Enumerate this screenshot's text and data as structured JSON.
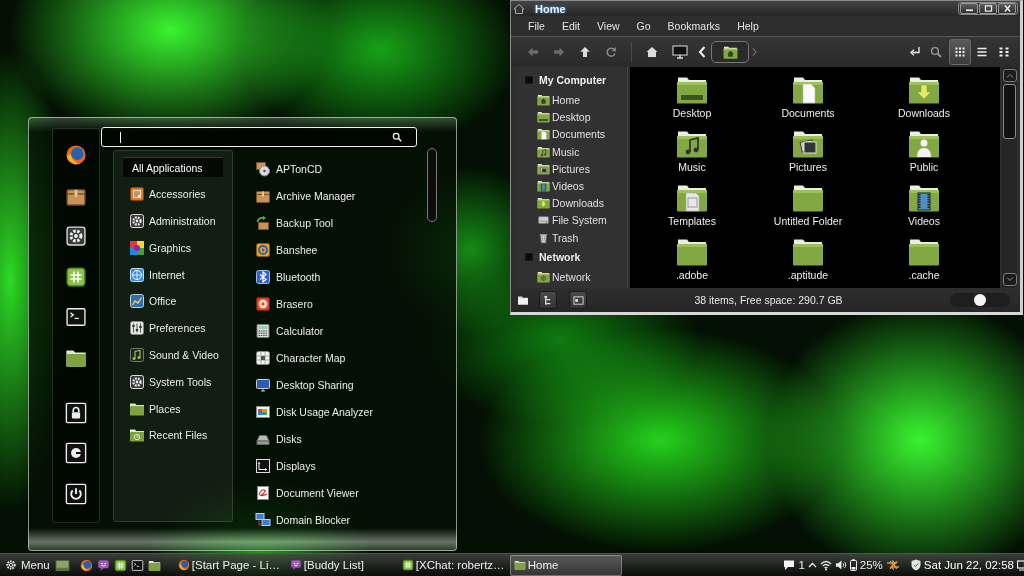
{
  "menu": {
    "categories": [
      {
        "label": "All Applications",
        "selected": true
      },
      {
        "label": "Accessories",
        "selected": false
      },
      {
        "label": "Administration",
        "selected": false
      },
      {
        "label": "Graphics",
        "selected": false
      },
      {
        "label": "Internet",
        "selected": false
      },
      {
        "label": "Office",
        "selected": false
      },
      {
        "label": "Preferences",
        "selected": false
      },
      {
        "label": "Sound & Video",
        "selected": false
      },
      {
        "label": "System Tools",
        "selected": false
      },
      {
        "label": "Places",
        "selected": false
      },
      {
        "label": "Recent Files",
        "selected": false
      }
    ],
    "applications": [
      "APTonCD",
      "Archive Manager",
      "Backup Tool",
      "Banshee",
      "Bluetooth",
      "Brasero",
      "Calculator",
      "Character Map",
      "Desktop Sharing",
      "Disk Usage Analyzer",
      "Disks",
      "Displays",
      "Document Viewer",
      "Domain Blocker"
    ]
  },
  "file_manager": {
    "title": "Home",
    "menu_bar": [
      "File",
      "Edit",
      "View",
      "Go",
      "Bookmarks",
      "Help"
    ],
    "view_modes": [
      {
        "kind": "icons",
        "selected": true
      },
      {
        "kind": "list",
        "selected": false
      },
      {
        "kind": "compact",
        "selected": false
      }
    ],
    "sidebar": [
      {
        "heading": "My Computer",
        "items": [
          {
            "label": "Home",
            "kind": "home"
          },
          {
            "label": "Desktop",
            "kind": "desktop"
          },
          {
            "label": "Documents",
            "kind": "documents"
          },
          {
            "label": "Music",
            "kind": "music"
          },
          {
            "label": "Pictures",
            "kind": "pictures"
          },
          {
            "label": "Videos",
            "kind": "videos"
          },
          {
            "label": "Downloads",
            "kind": "downloads"
          },
          {
            "label": "File System",
            "kind": "drive"
          },
          {
            "label": "Trash",
            "kind": "trash"
          }
        ]
      },
      {
        "heading": "Network",
        "items": [
          {
            "label": "Network",
            "kind": "network"
          }
        ]
      }
    ],
    "files": [
      {
        "label": "Desktop",
        "kind": "desktop"
      },
      {
        "label": "Documents",
        "kind": "documents"
      },
      {
        "label": "Downloads",
        "kind": "downloads"
      },
      {
        "label": "Music",
        "kind": "music"
      },
      {
        "label": "Pictures",
        "kind": "pictures"
      },
      {
        "label": "Public",
        "kind": "public"
      },
      {
        "label": "Templates",
        "kind": "templates"
      },
      {
        "label": "Untitled Folder",
        "kind": "plain"
      },
      {
        "label": "Videos",
        "kind": "videos"
      },
      {
        "label": ".adobe",
        "kind": "plain"
      },
      {
        "label": ".aptitude",
        "kind": "plain"
      },
      {
        "label": ".cache",
        "kind": "plain"
      }
    ],
    "status_bar": {
      "text": "38 items, Free space: 290.7 GB",
      "zoom": {
        "level": 0.5
      }
    }
  },
  "taskbar": {
    "menu_label": "Menu",
    "windows": [
      {
        "label": "[Start Page - Li…",
        "kind": "browser",
        "selected": false
      },
      {
        "label": "[Buddy List]",
        "kind": "messenger",
        "selected": false
      },
      {
        "label": "[XChat: robertz…",
        "kind": "chat",
        "selected": false
      },
      {
        "label": "Home",
        "kind": "folder",
        "selected": true
      }
    ],
    "tray": {
      "notifications": "1",
      "battery": "25%",
      "clock": "Sat Jun 22, 02:58"
    }
  }
}
